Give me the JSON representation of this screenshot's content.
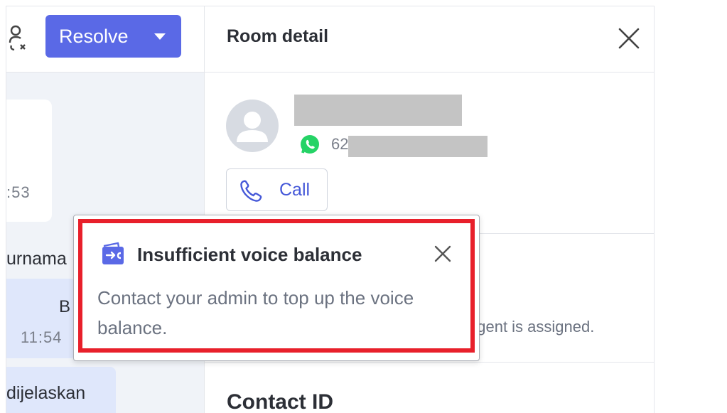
{
  "chat": {
    "resolve_label": "Resolve",
    "message_time_1": ":53",
    "message_text_1": "urnama",
    "message_letter_2": "B",
    "message_time_2": "11:54",
    "message_text_3": "dijelaskan"
  },
  "room_detail": {
    "title": "Room detail",
    "phone_prefix": "62",
    "call_label": "Call",
    "assignment_text": "agent is assigned.",
    "contact_id_heading": "Contact ID"
  },
  "toast": {
    "title": "Insufficient voice balance",
    "message": "Contact your admin to top up the voice balance.",
    "highlight_color": "#e8202b"
  },
  "icons": [
    "agent-icon",
    "caret-down-icon",
    "close-icon",
    "avatar-icon",
    "whatsapp-icon",
    "phone-icon",
    "wallet-icon"
  ],
  "colors": {
    "primary": "#5a69e6",
    "link": "#4558d8",
    "whatsapp": "#25d366"
  }
}
